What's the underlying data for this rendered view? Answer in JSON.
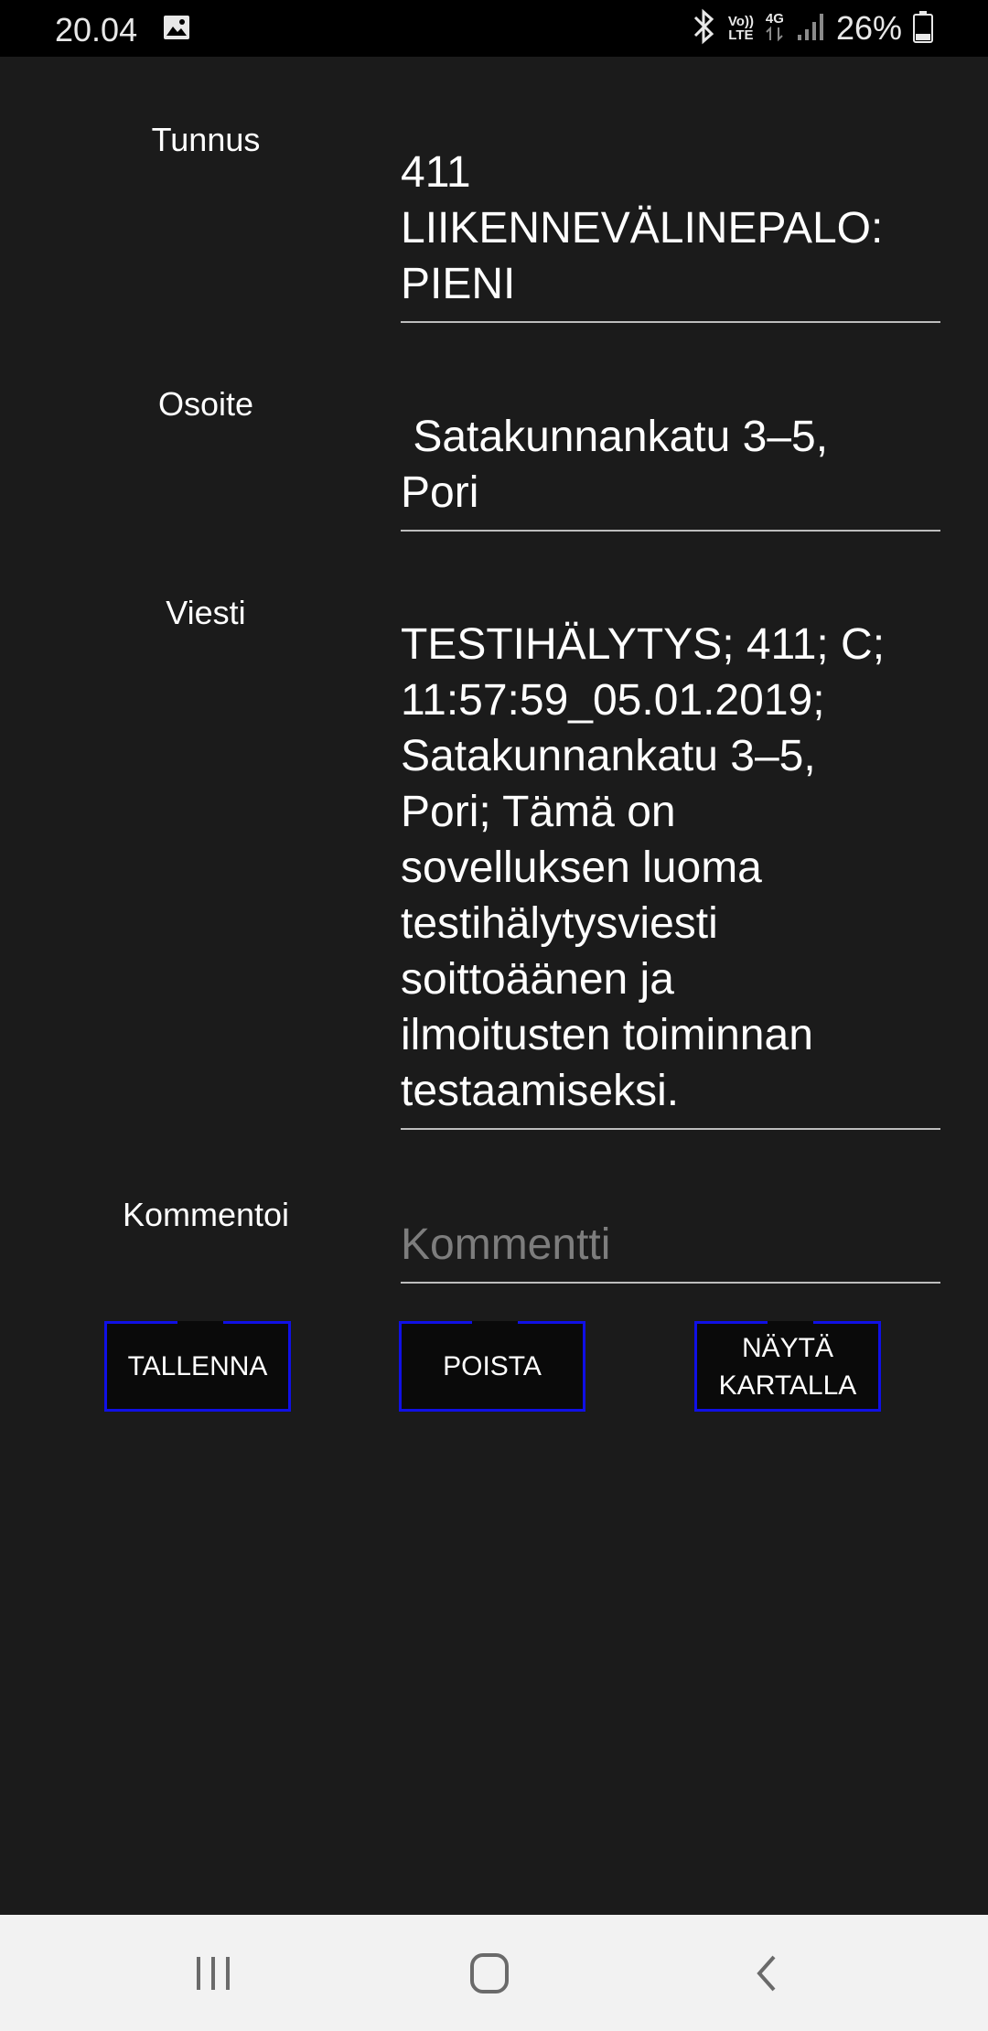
{
  "status_bar": {
    "time": "20.04",
    "volte_top": "Vo))",
    "volte_bottom": "LTE",
    "network": "4G",
    "battery": "26%"
  },
  "form": {
    "tunnus_label": "Tunnus",
    "tunnus_value": "411\nLIIKENNEVÄLINEPALO:\nPIENI",
    "osoite_label": "Osoite",
    "osoite_value": " Satakunnankatu 3–5,\nPori",
    "viesti_label": "Viesti",
    "viesti_value": "TESTIHÄLYTYS; 411; C;\n11:57:59_05.01.2019;\nSatakunnankatu 3–5,\nPori; Tämä on\nsovelluksen luoma\ntestihälytysviesti\nsoittoäänen ja\nilmoitusten toiminnan\ntestaamiseksi.",
    "kommentoi_label": "Kommentoi",
    "kommentti_placeholder": "Kommentti"
  },
  "buttons": {
    "save": "TALLENNA",
    "delete": "POISTA",
    "show_on_map": "NÄYTÄ\nKARTALLA"
  },
  "icons": {
    "gallery": "image-icon",
    "bluetooth": "bluetooth-icon",
    "signal": "signal-icon",
    "battery": "battery-icon",
    "recents": "recent-apps-icon",
    "home": "home-icon",
    "back": "back-icon"
  },
  "colors": {
    "background": "#1b1b1b",
    "button_border": "#1010e6",
    "status_bar": "#000000",
    "nav_bar": "#f2f2f2"
  }
}
